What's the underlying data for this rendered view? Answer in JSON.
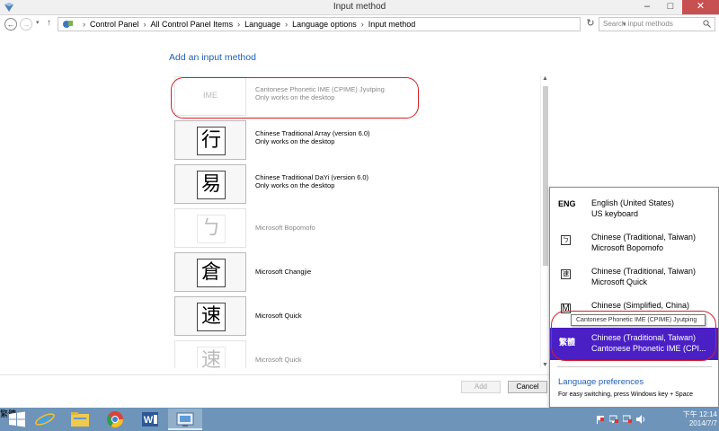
{
  "window": {
    "title": "Input method",
    "min_glyph": "–",
    "max_glyph": "□",
    "close_glyph": "✕"
  },
  "nav": {
    "back_glyph": "←",
    "forward_glyph": "→",
    "dropdown_glyph": "▾",
    "up_glyph": "↑",
    "refresh_glyph": "↻"
  },
  "breadcrumb": [
    "Control Panel",
    "All Control Panel Items",
    "Language",
    "Language options",
    "Input method"
  ],
  "breadcrumb_sep": "›",
  "search": {
    "placeholder": "Search input methods"
  },
  "main": {
    "heading": "Add an input method",
    "items": [
      {
        "glyph": "IME",
        "name": "Cantonese Phonetic IME (CPIME) Jyutping",
        "sub": "Only works on the desktop"
      },
      {
        "glyph": "行",
        "name": "Chinese Traditional Array (version 6.0)",
        "sub": "Only works on the desktop"
      },
      {
        "glyph": "易",
        "name": "Chinese Traditional DaYi (version 6.0)",
        "sub": "Only works on the desktop"
      },
      {
        "glyph": "ㄅ",
        "name": "Microsoft Bopomofo",
        "sub": ""
      },
      {
        "glyph": "倉",
        "name": "Microsoft Changjie",
        "sub": ""
      },
      {
        "glyph": "速",
        "name": "Microsoft Quick",
        "sub": ""
      },
      {
        "glyph": "速",
        "name": "Microsoft Quick",
        "sub": ""
      }
    ],
    "scroll_up": "▲",
    "scroll_down": "▼",
    "add_label": "Add",
    "cancel_label": "Cancel"
  },
  "flyout": {
    "languages": [
      {
        "code": "ENG",
        "line1": "English (United States)",
        "line2": "US keyboard"
      },
      {
        "code": "ㄅ",
        "line1": "Chinese (Traditional, Taiwan)",
        "line2": "Microsoft Bopomofo"
      },
      {
        "code": "速",
        "line1": "Chinese (Traditional, Taiwan)",
        "line2": "Microsoft Quick"
      },
      {
        "code": "M",
        "line1": "Chinese (Simplified, China)",
        "line2": ""
      },
      {
        "code": "繁體",
        "line1": "Chinese (Traditional, Taiwan)",
        "line2": "Cantonese Phonetic IME (CPI..."
      }
    ],
    "tooltip": "Cantonese Phonetic IME (CPIME) Jyutping",
    "preferences_link": "Language preferences",
    "hint": "For easy switching, press Windows key + Space"
  },
  "taskbar": {
    "ime_indicator": "繁體",
    "time": "下午 12:14",
    "date": "2014/7/7"
  },
  "colors": {
    "link": "#1e5fb4",
    "selected_language": "#4a1fc4",
    "annotation_red": "#d62027",
    "taskbar": "#6e94b9",
    "close_button": "#c75050"
  }
}
